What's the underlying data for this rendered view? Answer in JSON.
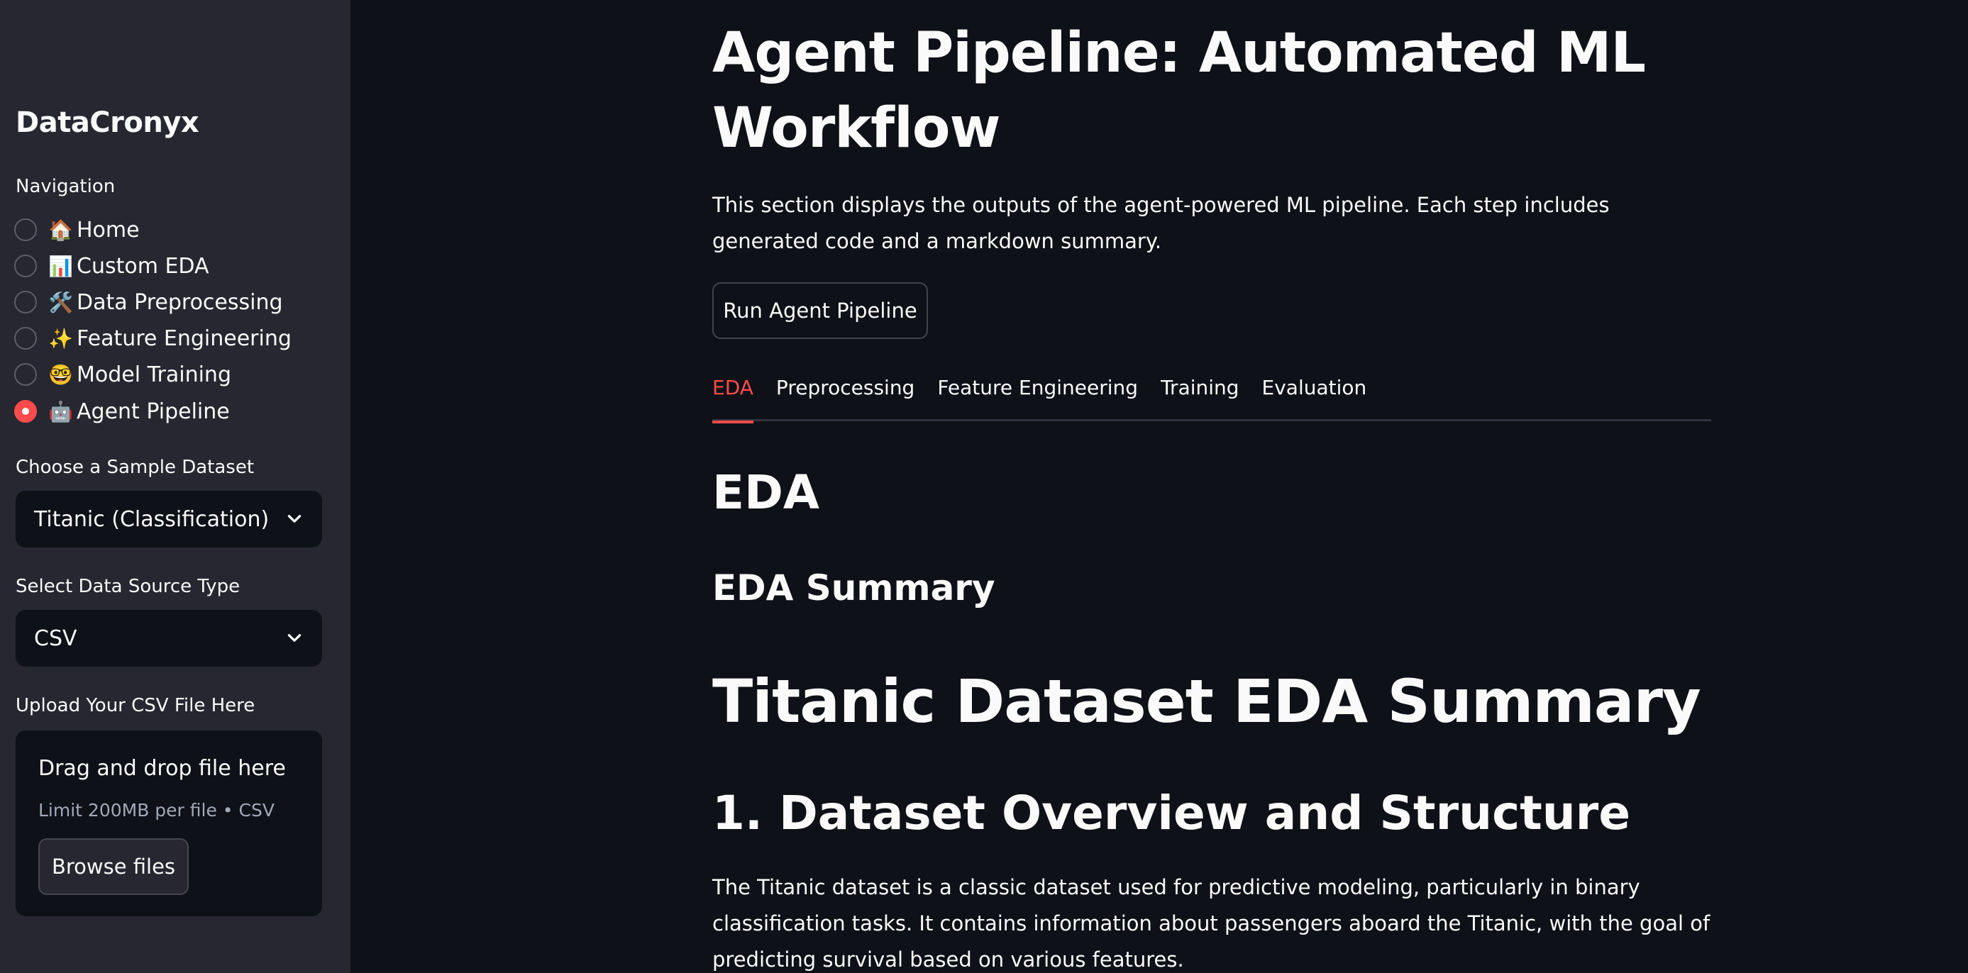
{
  "sidebar": {
    "brand": "DataCronyx",
    "navigation_label": "Navigation",
    "nav_items": [
      {
        "icon": "🏠",
        "label": "Home",
        "selected": false
      },
      {
        "icon": "📊",
        "label": "Custom EDA",
        "selected": false
      },
      {
        "icon": "🛠️",
        "label": "Data Preprocessing",
        "selected": false
      },
      {
        "icon": "✨",
        "label": "Feature Engineering",
        "selected": false
      },
      {
        "icon": "🤓",
        "label": "Model Training",
        "selected": false
      },
      {
        "icon": "🤖",
        "label": "Agent Pipeline",
        "selected": true
      }
    ],
    "dataset_label": "Choose a Sample Dataset",
    "dataset_value": "Titanic (Classification)",
    "source_label": "Select Data Source Type",
    "source_value": "CSV",
    "upload_label": "Upload Your CSV File Here",
    "upload": {
      "title": "Drag and drop file here",
      "limit": "Limit 200MB per file • CSV",
      "browse": "Browse files"
    }
  },
  "main": {
    "title": "Agent Pipeline: Automated ML Workflow",
    "description": "This section displays the outputs of the agent-powered ML pipeline. Each step includes generated code and a markdown summary.",
    "run_button": "Run Agent Pipeline",
    "tabs": [
      "EDA",
      "Preprocessing",
      "Feature Engineering",
      "Training",
      "Evaluation"
    ],
    "active_tab": "EDA",
    "heading_section": "EDA",
    "heading_summary": "EDA Summary",
    "heading_report": "Titanic Dataset EDA Summary",
    "heading_overview": "1. Dataset Overview and Structure",
    "paragraph": "The Titanic dataset is a classic dataset used for predictive modeling, particularly in binary classification tasks. It contains information about passengers aboard the Titanic, with the goal of predicting survival based on various features."
  },
  "colors": {
    "background": "#0e1117",
    "sidebar": "#262730",
    "accent": "#ff4b4b",
    "text": "#fafafa",
    "muted": "#a3a8b8"
  }
}
